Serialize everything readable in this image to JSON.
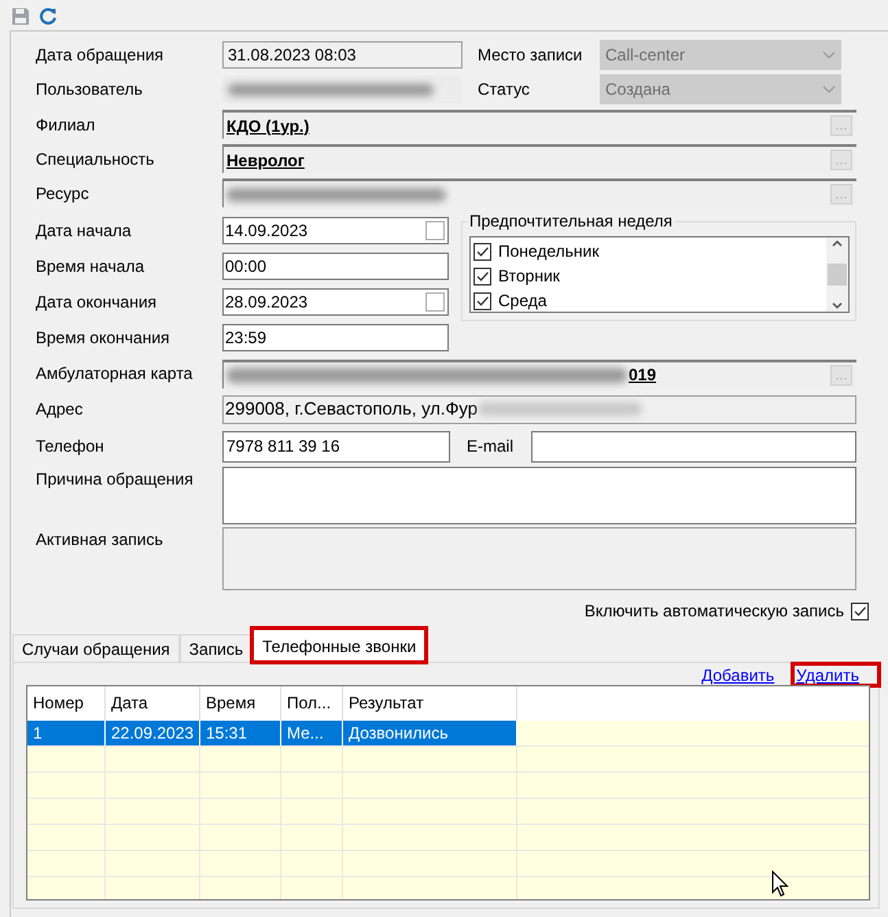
{
  "toolbar": [
    {
      "kind": "save",
      "disabled": true
    },
    {
      "kind": "refresh",
      "disabled": false
    }
  ],
  "header_rows": [
    {
      "label": "Дата обращения",
      "field": {
        "kind": "readonly",
        "value": "31.08.2023 08:03"
      },
      "right": {
        "label": "Место записи",
        "value": "Call-center",
        "disabled": true
      }
    },
    {
      "label": "Пользователь",
      "field": {
        "kind": "redacted"
      },
      "right": {
        "label": "Статус",
        "value": "Создана",
        "disabled": true
      }
    }
  ],
  "lookup_rows": [
    {
      "label": "Филиал",
      "value": "КДО (1ур.)",
      "redacted": false
    },
    {
      "label": "Специальность",
      "value": "Невролог",
      "redacted": false
    },
    {
      "label": "Ресурс",
      "redacted": true
    }
  ],
  "period_rows": [
    {
      "label": "Дата начала",
      "value": "14.09.2023",
      "kind": "date",
      "checked": false
    },
    {
      "label": "Время начала",
      "value": "00:00",
      "kind": "time"
    },
    {
      "label": "Дата окончания",
      "value": "28.09.2023",
      "kind": "date",
      "checked": false
    },
    {
      "label": "Время окончания",
      "value": "23:59",
      "kind": "time"
    }
  ],
  "preferred_week": {
    "title": "Предпочтительная неделя",
    "days": [
      {
        "label": "Понедельник",
        "checked": true
      },
      {
        "label": "Вторник",
        "checked": true
      },
      {
        "label": "Среда",
        "checked": true
      }
    ]
  },
  "card": {
    "label": "Амбулаторная карта",
    "value_tail": "019"
  },
  "address": {
    "label": "Адрес",
    "value": "299008, г.Севастополь, ул.Фур"
  },
  "phone": {
    "label": "Телефон",
    "value": "7978 811 39 16"
  },
  "email": {
    "label": "E-mail"
  },
  "reason": {
    "label": "Причина обращения"
  },
  "active_record": {
    "label": "Активная запись",
    "disabled": true
  },
  "auto_record": {
    "label": "Включить автоматическую запись",
    "checked": true
  },
  "tabs": [
    {
      "label": "Случаи обращения",
      "selected": false,
      "highlighted": false
    },
    {
      "label": "Запись",
      "selected": false,
      "highlighted": false
    },
    {
      "label": "Телефонные звонки",
      "selected": true,
      "highlighted": true
    }
  ],
  "links": [
    {
      "label": "Добавить",
      "highlighted": false
    },
    {
      "label": "Удалить",
      "highlighted": true
    }
  ],
  "grid": {
    "columns": [
      "Номер",
      "Дата",
      "Время",
      "Пол...",
      "Результат"
    ],
    "rows": [
      {
        "cells": [
          "1",
          "22.09.2023",
          "15:31",
          "Ме...",
          "Дозвонились"
        ],
        "selected": true
      }
    ]
  }
}
